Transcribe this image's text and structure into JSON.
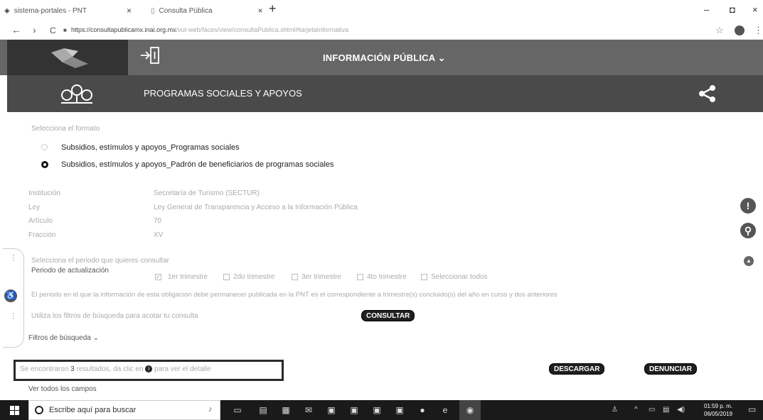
{
  "browser": {
    "tabs": [
      {
        "title": "sistema-portales - PNT",
        "close": "×"
      },
      {
        "title": "Consulta Pública",
        "close": "×"
      }
    ],
    "new_tab": "+",
    "window_controls": {
      "minimize": "–",
      "maximize": "◘",
      "close": "×"
    },
    "nav": {
      "back": "←",
      "forward": "›",
      "reload": "C"
    },
    "url_host": "https://consultapublicamx.inai.org.mx",
    "url_path": "/vut-web/faces/view/consultaPublica.xhtml#tarjetaInformativa",
    "star": "☆",
    "menu": "⋮"
  },
  "header": {
    "title": "INFORMACIÓN PÚBLICA ⌄",
    "section_title": "PROGRAMAS SOCIALES Y APOYOS"
  },
  "form": {
    "format_label": "Selecciona el formato",
    "formats": [
      {
        "label": "Subsidios, estímulos y apoyos_Programas sociales",
        "selected": false
      },
      {
        "label": "Subsidios, estímulos y apoyos_Padrón de beneficiarios de programas sociales",
        "selected": true
      }
    ],
    "info_rows": [
      {
        "label": "Institución",
        "value": "Secretaría de Turismo (SECTUR)"
      },
      {
        "label": "Ley",
        "value": "Ley General de Transparencia y Acceso a la Información Pública"
      },
      {
        "label": "Artículo",
        "value": "70"
      },
      {
        "label": "Fracción",
        "value": "XV"
      }
    ],
    "period_label": "Selecciona el periodo que quieres consultar",
    "update_label": "Periodo de actualización",
    "periods": [
      "1er trimestre",
      "2do trimestre",
      "3er trimestre",
      "4to trimestre",
      "Seleccionar todos"
    ],
    "period_note": "El periodo en el que la información de esta obligación debe permanecer publicada en la PNT es el correspondiente a trimestre(s) concluido(s) del año en curso y dos anteriores",
    "filter_hint": "Utiliza los filtros de búsqueda para acotar tu consulta",
    "consult_button": "CONSULTAR",
    "filters_toggle": "Filtros de búsqueda ⌄",
    "result_prefix": "Se encontraron",
    "result_count": "3",
    "result_middle": "resultados, da clic en",
    "result_icon": "i",
    "result_suffix": "para ver el detalle",
    "download_button": "DESCARGAR",
    "report_button": "DENUNCIAR",
    "all_fields": "Ver todos los campos"
  },
  "side_buttons": {
    "alert": "!",
    "search": "⚲",
    "up": "▲"
  },
  "taskbar": {
    "search_placeholder": "Escribe aquí para buscar",
    "time": "01:59 p. m.",
    "date": "06/05/2019"
  },
  "colors": {
    "header": "#666666",
    "subheader": "#4a4a4a",
    "logo_box": "#333333",
    "button": "#1f1f1f"
  }
}
